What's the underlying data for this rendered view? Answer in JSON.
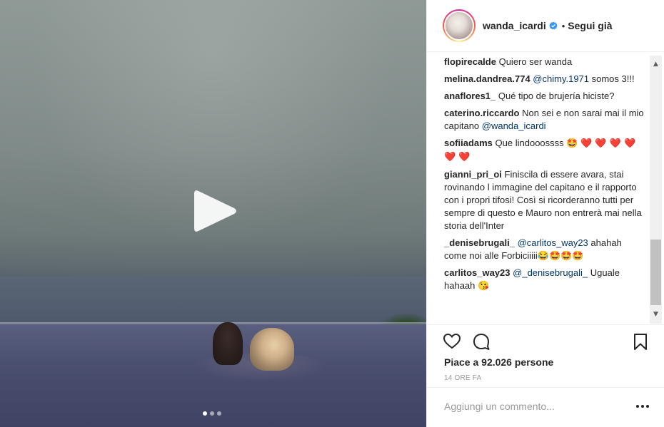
{
  "post": {
    "username": "wanda_icardi",
    "bullet": "•",
    "follow_label": "Segui già",
    "media": {
      "type": "video",
      "carousel_count": 3,
      "active_index": 0
    }
  },
  "comments": [
    {
      "author": "flopirecalde",
      "parts": [
        {
          "t": "text",
          "v": "Quiero ser wanda"
        }
      ]
    },
    {
      "author": "melina.dandrea.774",
      "parts": [
        {
          "t": "mention",
          "v": "@chimy.1971"
        },
        {
          "t": "text",
          "v": " somos 3!!!"
        }
      ]
    },
    {
      "author": "anaflores1_",
      "parts": [
        {
          "t": "text",
          "v": "Qué tipo de brujería hiciste?"
        }
      ]
    },
    {
      "author": "caterino.riccardo",
      "parts": [
        {
          "t": "text",
          "v": "Non sei e non sarai mai il mio capitano "
        },
        {
          "t": "mention",
          "v": "@wanda_icardi"
        }
      ]
    },
    {
      "author": "sofiiadams",
      "parts": [
        {
          "t": "text",
          "v": "Que lindooossss 🤩 "
        },
        {
          "t": "heart",
          "v": "❤️ ❤️ ❤️ ❤️ ❤️ ❤️"
        }
      ]
    },
    {
      "author": "gianni_pri_oi",
      "parts": [
        {
          "t": "text",
          "v": "Finiscila di essere avara, stai rovinando l immagine del capitano e il rapporto con i propri tifosi! Così si ricorderanno tutti per sempre di questo e Mauro non entrerà mai nella storia dell'Inter"
        }
      ]
    },
    {
      "author": "_denisebrugali_",
      "parts": [
        {
          "t": "mention",
          "v": "@carlitos_way23"
        },
        {
          "t": "text",
          "v": " ahahah come noi alle Forbiciiiii😂🤩🤩🤩"
        }
      ]
    },
    {
      "author": "carlitos_way23",
      "parts": [
        {
          "t": "mention",
          "v": "@_denisebrugali_"
        },
        {
          "t": "text",
          "v": " Uguale hahaah 😘"
        }
      ]
    }
  ],
  "actions": {
    "like_icon": "heart-outline-icon",
    "comment_icon": "comment-bubble-icon",
    "save_icon": "bookmark-icon"
  },
  "likes_text": "Piace a 92.026 persone",
  "time_text": "14 ORE FA",
  "comment_box": {
    "placeholder": "Aggiungi un commento..."
  },
  "colors": {
    "mention": "#003569",
    "text": "#262626",
    "muted": "#999999",
    "verified": "#3897f0"
  }
}
